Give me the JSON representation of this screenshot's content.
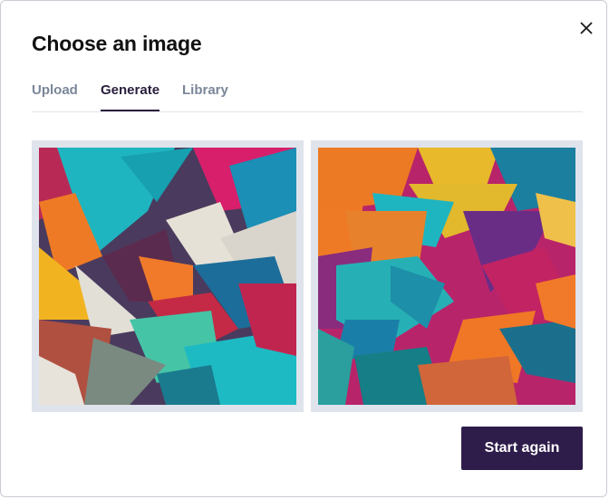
{
  "dialog": {
    "title": "Choose an image",
    "close_icon": "close-icon"
  },
  "tabs": [
    {
      "label": "Upload",
      "active": false
    },
    {
      "label": "Generate",
      "active": true
    },
    {
      "label": "Library",
      "active": false
    }
  ],
  "images": [
    {
      "description_icon": "origami-image"
    },
    {
      "description_icon": "origami-image"
    }
  ],
  "actions": {
    "start_again_label": "Start again"
  },
  "colors": {
    "accent": "#2e1d4a",
    "active_tab_text": "#2b1f3f",
    "inactive_tab_text": "#7a8699",
    "image_frame": "#dfe3ec"
  }
}
